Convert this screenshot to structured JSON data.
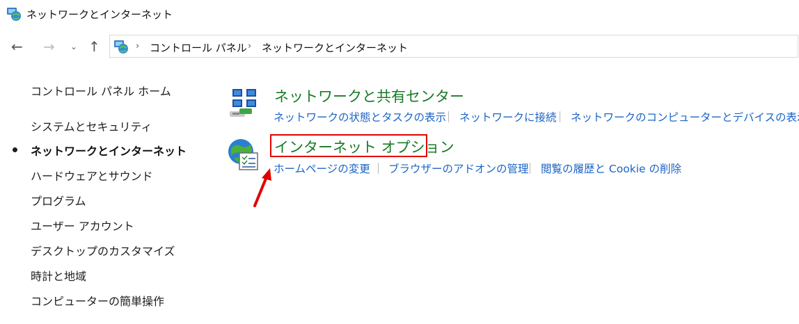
{
  "window": {
    "title": "ネットワークとインターネット"
  },
  "nav": {
    "back_glyph": "←",
    "forward_glyph": "→",
    "recent_glyph": "⌄",
    "up_glyph": "↑"
  },
  "breadcrumb": {
    "items": [
      "コントロール パネル",
      "ネットワークとインターネット"
    ],
    "separator": "›"
  },
  "sidebar": {
    "home_label": "コントロール パネル ホーム",
    "items": [
      {
        "label": "システムとセキュリティ",
        "current": false
      },
      {
        "label": "ネットワークとインターネット",
        "current": true
      },
      {
        "label": "ハードウェアとサウンド",
        "current": false
      },
      {
        "label": "プログラム",
        "current": false
      },
      {
        "label": "ユーザー アカウント",
        "current": false
      },
      {
        "label": "デスクトップのカスタマイズ",
        "current": false
      },
      {
        "label": "時計と地域",
        "current": false
      },
      {
        "label": "コンピューターの簡単操作",
        "current": false
      }
    ]
  },
  "categories": [
    {
      "title": "ネットワークと共有センター",
      "icon": "network-sharing-icon",
      "links": [
        "ネットワークの状態とタスクの表示",
        "ネットワークに接続",
        "ネットワークのコンピューターとデバイスの表示"
      ]
    },
    {
      "title": "インターネット オプション",
      "icon": "internet-options-icon",
      "links": [
        "ホームページの変更",
        "ブラウザーのアドオンの管理",
        "閲覧の履歴と Cookie の削除"
      ]
    }
  ],
  "colors": {
    "category_title": "#177b26",
    "link": "#1a64c6",
    "highlight": "#e10000"
  }
}
